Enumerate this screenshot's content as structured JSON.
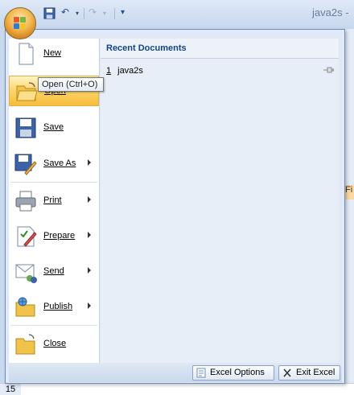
{
  "window": {
    "title": "java2s -"
  },
  "quick_access": {
    "save_icon": "save-icon",
    "undo_icon": "undo-icon",
    "redo_icon": "redo-icon",
    "customize_icon": "customize-qat-icon"
  },
  "office_button": {
    "icon": "office-logo-icon"
  },
  "menu": {
    "items": [
      {
        "label": "New",
        "icon": "new-document-icon",
        "submenu": false
      },
      {
        "label": "Open",
        "icon": "open-folder-icon",
        "submenu": false,
        "highlighted": true
      },
      {
        "label": "Save",
        "icon": "save-disk-icon",
        "submenu": false
      },
      {
        "label": "Save As",
        "icon": "save-as-icon",
        "submenu": true
      },
      {
        "label": "Print",
        "icon": "printer-icon",
        "submenu": true
      },
      {
        "label": "Prepare",
        "icon": "prepare-icon",
        "submenu": true
      },
      {
        "label": "Send",
        "icon": "send-icon",
        "submenu": true
      },
      {
        "label": "Publish",
        "icon": "publish-icon",
        "submenu": true
      },
      {
        "label": "Close",
        "icon": "close-folder-icon",
        "submenu": false
      }
    ],
    "tooltip": "Open (Ctrl+O)"
  },
  "recent": {
    "header": "Recent Documents",
    "documents": [
      {
        "number": "1",
        "name": "java2s"
      }
    ]
  },
  "footer": {
    "options_label": "Excel Options",
    "exit_label": "Exit Excel"
  },
  "background": {
    "partial_tab": "Fi",
    "row_number": "15"
  },
  "colors": {
    "highlight": "#fcd468",
    "accent": "#15428b"
  }
}
